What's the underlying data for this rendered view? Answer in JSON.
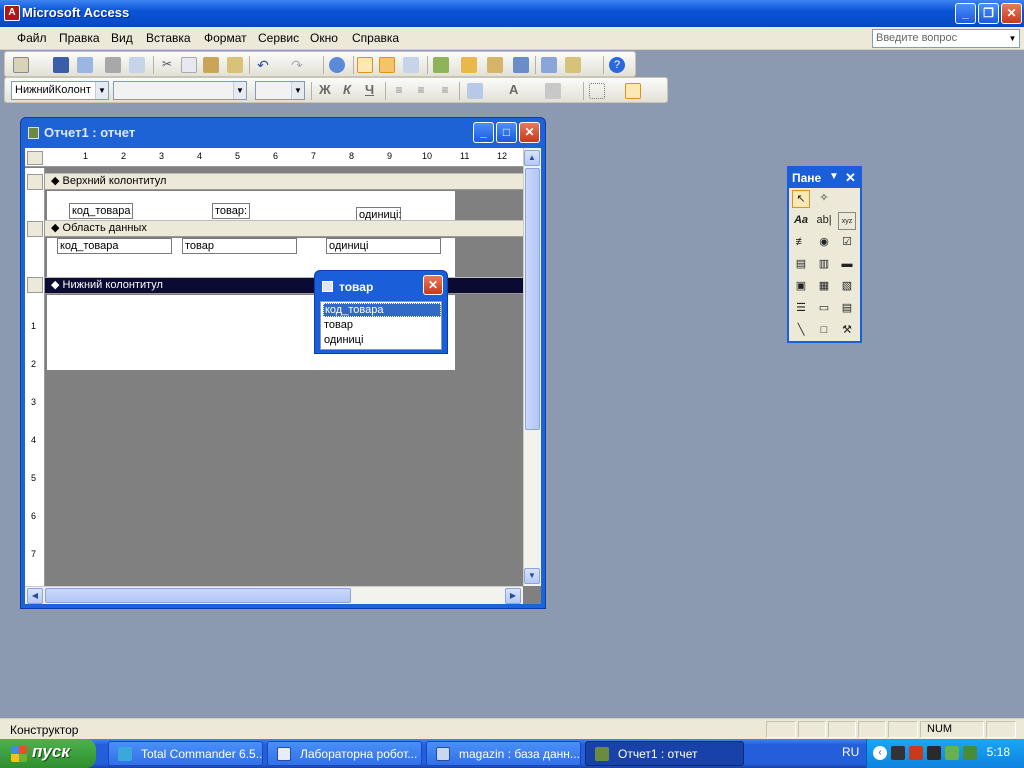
{
  "app": {
    "title": "Microsoft Access"
  },
  "menubar": {
    "items": [
      "Файл",
      "Правка",
      "Вид",
      "Вставка",
      "Формат",
      "Сервис",
      "Окно",
      "Справка"
    ],
    "help_placeholder": "Введите вопрос"
  },
  "format_toolbar": {
    "object_combo": "НижнийКолонт",
    "font_combo": "",
    "size_combo": "",
    "bold": "Ж",
    "italic": "К",
    "underline": "Ч",
    "font_color": "A"
  },
  "report_window": {
    "title": "Отчет1 : отчет",
    "ruler_marks": [
      "1",
      "2",
      "3",
      "4",
      "5",
      "6",
      "7",
      "8",
      "9",
      "10",
      "11",
      "12"
    ],
    "vruler_marks": [
      "1",
      "2",
      "3",
      "4",
      "5",
      "6",
      "7"
    ],
    "sections": {
      "page_header": "Верхний колонтитул",
      "detail": "Область данных",
      "page_footer": "Нижний колонтитул"
    },
    "header_labels": [
      "код_товара",
      "товар:",
      "одиниці:"
    ],
    "detail_fields": [
      "код_товара",
      "товар",
      "одиниці"
    ]
  },
  "field_list": {
    "title": "товар",
    "items": [
      "код_товара",
      "товар",
      "одиниці"
    ],
    "selected_index": 0
  },
  "toolbox": {
    "title": "Пане"
  },
  "statusbar": {
    "text": "Конструктор",
    "num": "NUM"
  },
  "taskbar": {
    "start": "пуск",
    "tasks": [
      "Total Commander 6.5...",
      "Лабораторна робот...",
      "magazin : база данн...",
      "Отчет1 : отчет"
    ],
    "lang": "RU",
    "clock": "5:18"
  }
}
